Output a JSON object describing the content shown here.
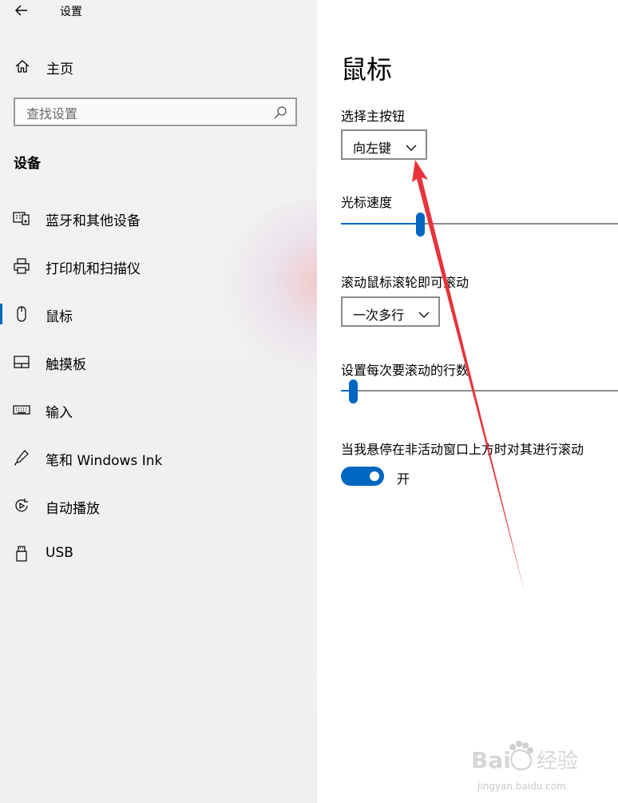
{
  "window": {
    "title": "设置"
  },
  "sidebar": {
    "home_label": "主页",
    "search_placeholder": "查找设置",
    "section_title": "设备",
    "items": [
      {
        "label": "蓝牙和其他设备",
        "icon": "bluetooth-devices-icon",
        "selected": false
      },
      {
        "label": "打印机和扫描仪",
        "icon": "printer-icon",
        "selected": false
      },
      {
        "label": "鼠标",
        "icon": "mouse-icon",
        "selected": true
      },
      {
        "label": "触摸板",
        "icon": "touchpad-icon",
        "selected": false
      },
      {
        "label": "输入",
        "icon": "keyboard-icon",
        "selected": false
      },
      {
        "label": "笔和 Windows Ink",
        "icon": "pen-icon",
        "selected": false
      },
      {
        "label": "自动播放",
        "icon": "autoplay-icon",
        "selected": false
      },
      {
        "label": "USB",
        "icon": "usb-icon",
        "selected": false
      }
    ]
  },
  "main": {
    "title": "鼠标",
    "primary_button": {
      "label": "选择主按钮",
      "value": "向左键"
    },
    "cursor_speed": {
      "label": "光标速度",
      "value_fraction": 0.27
    },
    "scroll_mode": {
      "label": "滚动鼠标滚轮即可滚动",
      "value": "一次多行"
    },
    "lines_per_scroll": {
      "label": "设置每次要滚动的行数",
      "value_fraction": 0.03
    },
    "inactive_scroll": {
      "label": "当我悬停在非活动窗口上方时对其进行滚动",
      "state": "开",
      "on": true
    }
  },
  "colors": {
    "accent": "#0067c0",
    "annotation_arrow": "#e8333a",
    "sidebar_bg": "#f0f0f0"
  },
  "watermark": {
    "text": "Bai经验",
    "subtext": "jingyan.baidu.com"
  }
}
